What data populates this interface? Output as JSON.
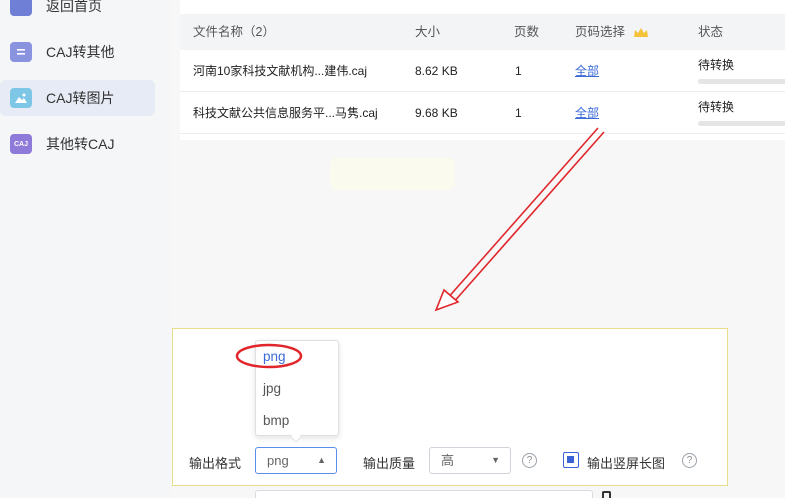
{
  "sidebar": {
    "items": [
      {
        "label": "返回首页",
        "icon": "home-icon"
      },
      {
        "label": "CAJ转其他",
        "icon": "document-icon"
      },
      {
        "label": "CAJ转图片",
        "icon": "image-icon",
        "active": true
      },
      {
        "label": "其他转CAJ",
        "icon": "caj-icon",
        "badge": "CAJ"
      }
    ]
  },
  "table": {
    "headers": {
      "name": "文件名称（2）",
      "size": "大小",
      "pages": "页数",
      "page_select": "页码选择",
      "status": "状态"
    },
    "rows": [
      {
        "name": "河南10家科技文献机构...建伟.caj",
        "size": "8.62 KB",
        "pages": "1",
        "page_select": "全部",
        "status": "待转换"
      },
      {
        "name": "科技文献公共信息服务平...马隽.caj",
        "size": "9.68 KB",
        "pages": "1",
        "page_select": "全部",
        "status": "待转换"
      }
    ]
  },
  "settings": {
    "format_label": "输出格式",
    "format_value": "png",
    "format_options": [
      "png",
      "jpg",
      "bmp"
    ],
    "quality_label": "输出质量",
    "quality_value": "高",
    "vertical_label": "输出竖屏长图",
    "vertical_checked": true,
    "help_glyph": "?"
  },
  "colors": {
    "accent": "#3a6ad8",
    "annotation": "#e0262b",
    "panel_border": "#e8dd8a"
  }
}
